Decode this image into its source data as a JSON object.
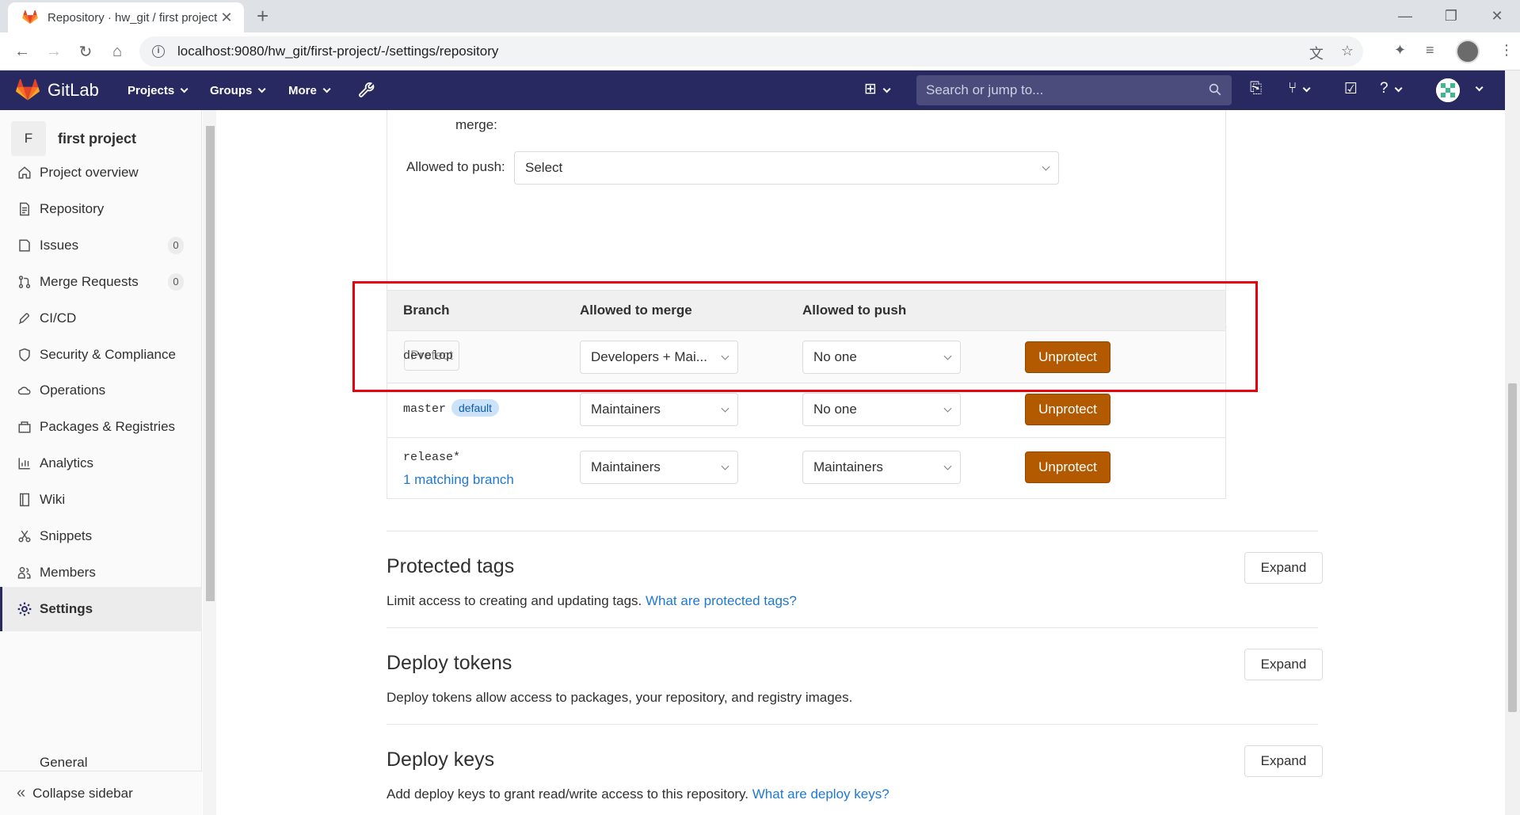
{
  "browser": {
    "tab_title": "Repository · hw_git / first project",
    "url": "localhost:9080/hw_git/first-project/-/settings/repository"
  },
  "gitlab": {
    "brand": "GitLab",
    "menu": [
      "Projects",
      "Groups",
      "More"
    ],
    "search_placeholder": "Search or jump to..."
  },
  "sidebar": {
    "project_letter": "F",
    "project_name": "first project",
    "items": [
      {
        "label": "Project overview",
        "icon": "home-icon"
      },
      {
        "label": "Repository",
        "icon": "document-icon"
      },
      {
        "label": "Issues",
        "icon": "issues-icon",
        "count": "0"
      },
      {
        "label": "Merge Requests",
        "icon": "merge-request-icon",
        "count": "0"
      },
      {
        "label": "CI/CD",
        "icon": "rocket-icon"
      },
      {
        "label": "Security & Compliance",
        "icon": "shield-icon"
      },
      {
        "label": "Operations",
        "icon": "cloud-gear-icon"
      },
      {
        "label": "Packages & Registries",
        "icon": "package-icon"
      },
      {
        "label": "Analytics",
        "icon": "chart-icon"
      },
      {
        "label": "Wiki",
        "icon": "book-icon"
      },
      {
        "label": "Snippets",
        "icon": "scissors-icon"
      },
      {
        "label": "Members",
        "icon": "users-icon"
      },
      {
        "label": "Settings",
        "icon": "gear-icon"
      }
    ],
    "sub_item": "General",
    "collapse": "Collapse sidebar"
  },
  "form": {
    "merge_label_tail": "merge:",
    "push_label": "Allowed to push:",
    "push_value": "Select",
    "protect_button": "Protect"
  },
  "table": {
    "headers": [
      "Branch",
      "Allowed to merge",
      "Allowed to push"
    ],
    "rows": [
      {
        "branch": "develop",
        "merge": "Developers + Mai...",
        "push": "No one",
        "action": "Unprotect"
      },
      {
        "branch": "master",
        "badge": "default",
        "merge": "Maintainers",
        "push": "No one",
        "action": "Unprotect"
      },
      {
        "branch": "release*",
        "matching": "1 matching branch",
        "merge": "Maintainers",
        "push": "Maintainers",
        "action": "Unprotect"
      }
    ]
  },
  "sections": [
    {
      "title": "Protected tags",
      "desc": "Limit access to creating and updating tags. ",
      "link": "What are protected tags?",
      "button": "Expand"
    },
    {
      "title": "Deploy tokens",
      "desc": "Deploy tokens allow access to packages, your repository, and registry images.",
      "link": "",
      "button": "Expand"
    },
    {
      "title": "Deploy keys",
      "desc": "Add deploy keys to grant read/write access to this repository. ",
      "link": "What are deploy keys?",
      "button": "Expand"
    }
  ],
  "colors": {
    "header": "#292961",
    "unprotect": "#b35900",
    "highlight": "#e8000f",
    "link": "#1f78d1"
  }
}
